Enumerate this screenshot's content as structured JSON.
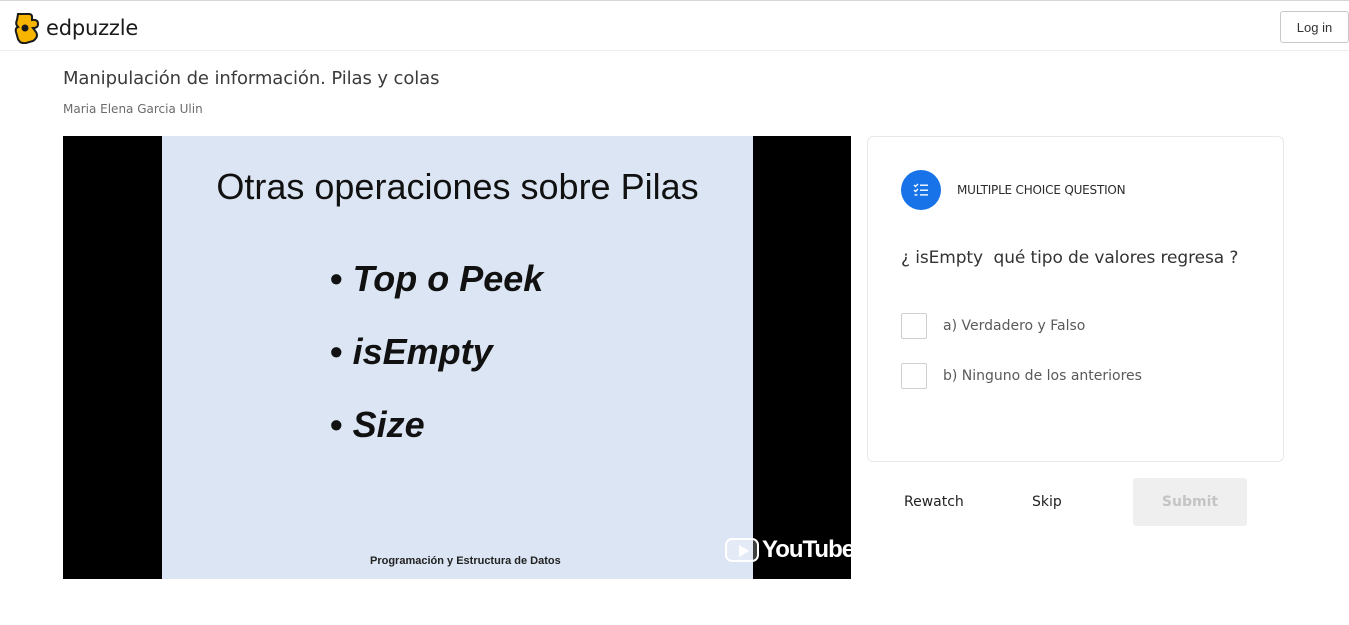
{
  "brand": {
    "name": "edpuzzle",
    "logo_color": "#f7b500"
  },
  "header": {
    "login_label": "Log in"
  },
  "lesson": {
    "title": "Manipulación de información. Pilas y colas",
    "author": "Maria Elena Garcia Ulin"
  },
  "video": {
    "slide_title": "Otras operaciones sobre Pilas",
    "bullets": [
      "Top o Peek",
      "isEmpty",
      "Size"
    ],
    "bullet_glyph": "•",
    "footer": "Programación y Estructura de Datos",
    "watermark": "YouTube"
  },
  "question": {
    "type_label": "MULTIPLE CHOICE QUESTION",
    "icon": "checklist-icon",
    "accent_color": "#1873e8",
    "text": "¿ isEmpty  qué tipo de valores regresa ?",
    "options": [
      {
        "label": "a) Verdadero y Falso",
        "checked": false
      },
      {
        "label": "b) Ninguno de los anteriores",
        "checked": false
      }
    ]
  },
  "actions": {
    "rewatch": "Rewatch",
    "skip": "Skip",
    "submit": "Submit"
  }
}
